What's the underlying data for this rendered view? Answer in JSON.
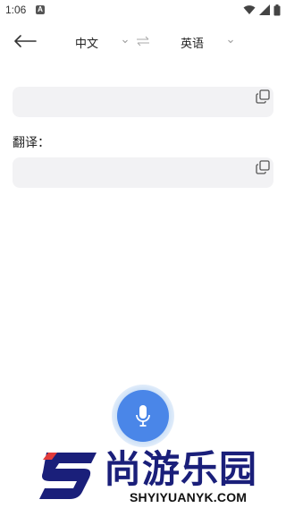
{
  "status_bar": {
    "time": "1:06",
    "notification_badge": "A"
  },
  "toolbar": {
    "source_language": "中文",
    "target_language": "英语"
  },
  "input_box": {
    "value": ""
  },
  "result": {
    "label": "翻译：",
    "value": ""
  },
  "watermark": {
    "chinese": "尚游乐园",
    "domain": "SHYIYUANYK.COM"
  },
  "colors": {
    "mic_button": "#4a86e8",
    "box_bg": "#f2f2f4",
    "watermark_blue": "#1a1f7a",
    "watermark_red": "#e23b3b"
  }
}
